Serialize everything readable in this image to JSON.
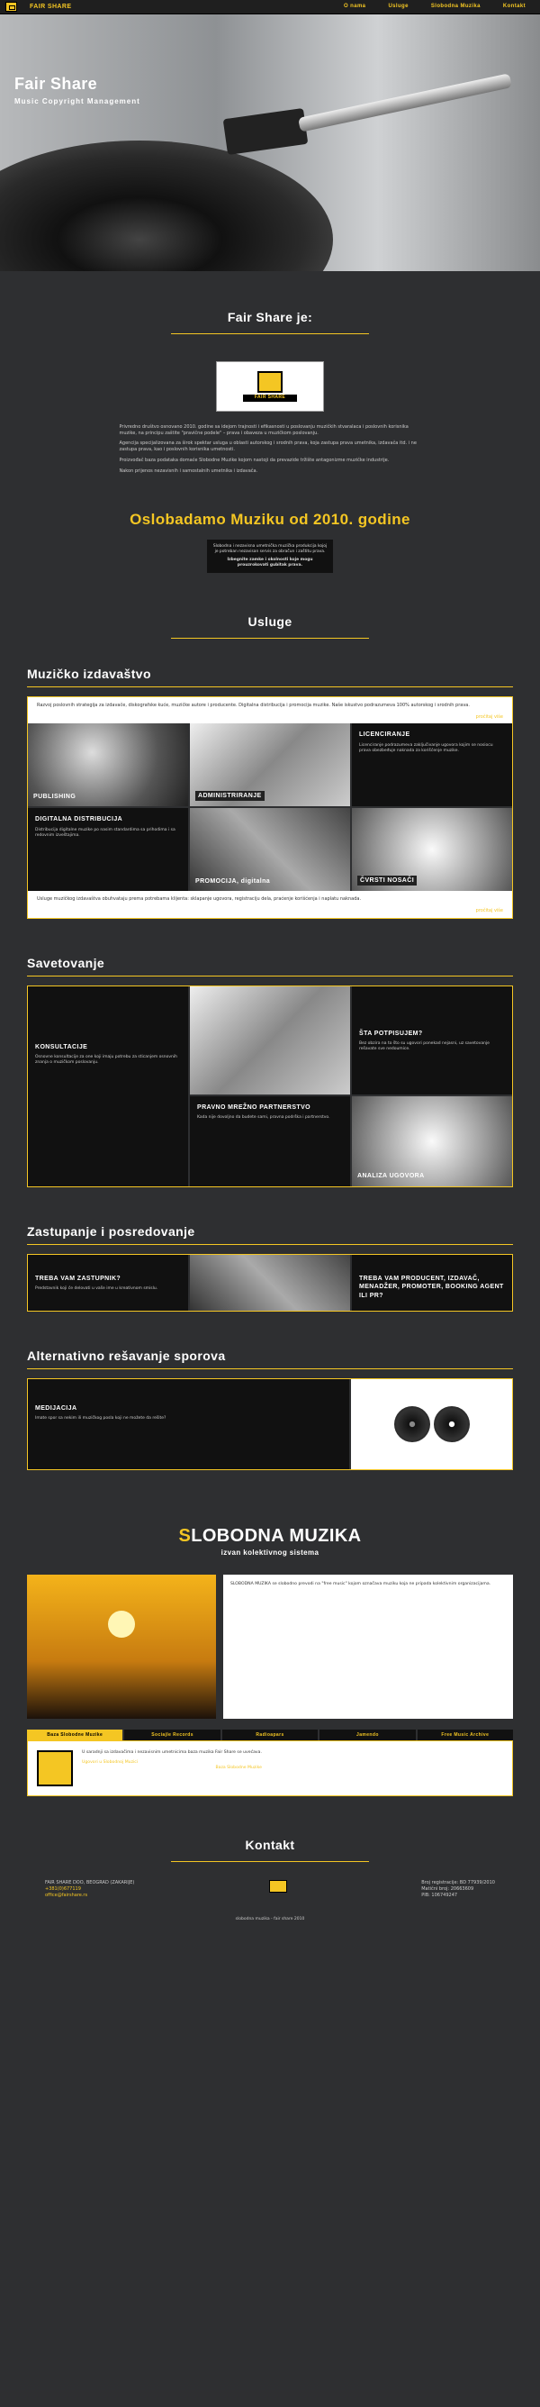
{
  "nav": {
    "brand": "FAIR SHARE",
    "links": [
      "O nama",
      "Usluge",
      "Slobodna Muzika",
      "Kontakt"
    ]
  },
  "hero": {
    "title": "Fair Share",
    "subtitle": "Music Copyright Management"
  },
  "about": {
    "heading": "Fair Share je:",
    "logo_text": "FAIR SHARE",
    "p1": "Privredno društvo osnovano 2010. godine sa idejom trajnosti i efikasnosti u poslovanju muzičkih stvaralaca i poslovnih korisnika muzike, na principu zaštite \"pravične podele\" – prava i obaveza u muzičkom poslovanju.",
    "p2": "Agencija specijalizovana za širok spektar usluga u oblasti autorskog i srodnih prava, koja zastupa prava umetnika, izdavača itd. i ne zastupa prava, kao i poslovnih korisnika umetnosti.",
    "p3": "Proizvođač baza podataka domaće Slobodne Muzike kojom nastoji da prevazide tržište antagonizme muzičke industrije.",
    "p4": "Nakon prijenos nezavisnih i samostalnih umetnika i izdavača."
  },
  "since": {
    "heading": "Oslobadamo Muziku od 2010. godine",
    "note1": "Slobodna i nezavisna umetnička muzička produkcija kojoj je potreban nezavisan servis za obračun i zaštitu prava.",
    "note2": "Izbegnite zamke i okolnosti koje mogu prouzrokovati gubitak prava."
  },
  "usluge": {
    "heading": "Usluge",
    "section1": "Muzičko izdavaštvo",
    "section1_text": "Razvoj poslovnih strategija za izdavače, diskografske kuće, muzičke autore i producente. Digitalna distribucija i promocija muzike. Naše iskustvo podrazumeva 100% autorskog i srodnih prava.",
    "more": "pročitaj više",
    "cells": [
      "PUBLISHING",
      "ADMINISTRIRANJE",
      "LICENCIRANJE",
      "DIGITALNA DISTRIBUCIJA",
      "PROMOCIJA, digitalna",
      "ČVRSTI NOSAČI"
    ],
    "licence_text": "Licenciranje podrazumeva zaključivanje ugovora kojim se nosiocu prava obezbeđuje naknada za korišćenje muzike.",
    "digital_text": "Distribucija digitalne muzike po nasim standardima sa prihodima i sa redovnim izveštajima.",
    "footer_text": "Usluge muzičkog izdavaštva obuhvataju prema potrebama klijenta: sklapanje ugovora, registraciju dela, praćenje korišćenja i naplatu naknada."
  },
  "savet": {
    "heading": "Savetovanje",
    "k_title": "KONSULTACIJE",
    "k_text": "Osnovne konsultacije za one koji imaju potrebu za sticanjem osnovnih znanja o muzičkom poslovanju.",
    "sta_title": "ŠTA POTPISUJEM?",
    "sta_text": "Bez obzira na to što su ugovori ponekad nejasni, uz savetovanje rešavate sve nedoumice.",
    "pravno_title": "PRAVNO MREŽNO PARTNERSTVO",
    "pravno_text": "Kada nije dovoljno da budete sami, pravna podrška i partnerstvo.",
    "analiza": "ANALIZA UGOVORA"
  },
  "zastup": {
    "heading": "Zastupanje i posredovanje",
    "t1": "TREBA VAM ZASTUPNIK?",
    "t1_text": "Predstavnik koji će delovati u vaše ime u kreativnom smislu.",
    "t2": "TREBA VAM PRODUCENT, IZDAVAČ, MENADŽER, PROMOTER, BOOKING AGENT ILI PR?"
  },
  "alt": {
    "heading": "Alternativno rešavanje sporova",
    "t": "MEDIJACIJA",
    "text": "Imate spor sa nekim ili muzičkog posla koji ne možete da rešite?"
  },
  "slobodna": {
    "heading_first": "S",
    "heading_rest": "LOBODNA MUZIKA",
    "sub": "izvan kolektivnog sistema",
    "text": "SLOBODNA MUZIKA se slobodno prevodi na \"free music\" kojom označava muziku koja ne pripada kolektivnim organizacijama.",
    "tabs": [
      "Baza Slobodne Muzike",
      "Sociajle Records",
      "Radioapars",
      "Jamendo",
      "Free Music Archive"
    ],
    "box_text": "U saradnji sa izdavačima i nezavisnim umetnicima baza muzika Fair Share se uvećava.",
    "link": "Ugovori u Slobodnoj Muzici",
    "link2": "Baza Slobodne Muzike"
  },
  "kontakt": {
    "heading": "Kontakt",
    "left": [
      "FAIR SHARE DOO, BEOGRAD (ZAKARIJE)",
      "+381(0)677119",
      "office@fairshare.rs"
    ],
    "right": [
      "Broj registracije: BD 77939/2010",
      "Matični broj: 20663609",
      "PIB: 106749247"
    ]
  },
  "footer": "slobodna muzika - fair share 2010"
}
